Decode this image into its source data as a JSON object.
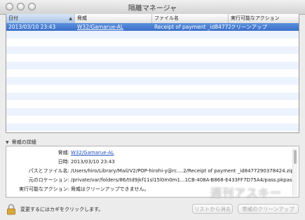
{
  "window": {
    "title": "隔離マネージャ"
  },
  "table": {
    "columns": [
      "日付",
      "脅威",
      "ファイル名",
      "実行可能なアクション"
    ],
    "rows": [
      {
        "date": "2013/03/10 23:43",
        "threat": "W32/Gamarue-AL",
        "file": "Receipt of payment _id84772...",
        "action": "クリーンアップ"
      }
    ]
  },
  "details": {
    "header": "脅威の詳細",
    "threat_label": "脅威:",
    "threat_value": "W32/Gamarue-AL",
    "date_label": "日時:",
    "date_value": "2013/03/10 23:43",
    "path_label": "パスとファイル名:",
    "path_value": "/Users/hiro/Library/Mail/V2/POP-hirohi-y@rc....2/Receipt of payment _id8477290378424.zip",
    "location_label": "元のロケーション:",
    "location_value": "/private/var/folders/86/ttd9jkf11sl15l0m0m1...1CB-408A-B868-E433FF7D75A4/pass.pkpass",
    "action_label": "実行可能なアクション:",
    "action_value": "脅威はクリーンアップできません。"
  },
  "status": {
    "lock_text": "変更するにはカギをクリックします。"
  },
  "buttons": {
    "remove": "リストから消去",
    "clean": "脅威のクリーンアップ"
  },
  "watermark": "週刊アスキー",
  "colors": {
    "selection": "#3a6fc8",
    "link": "#1d4fbf",
    "alt_row": "#edf3fe"
  }
}
